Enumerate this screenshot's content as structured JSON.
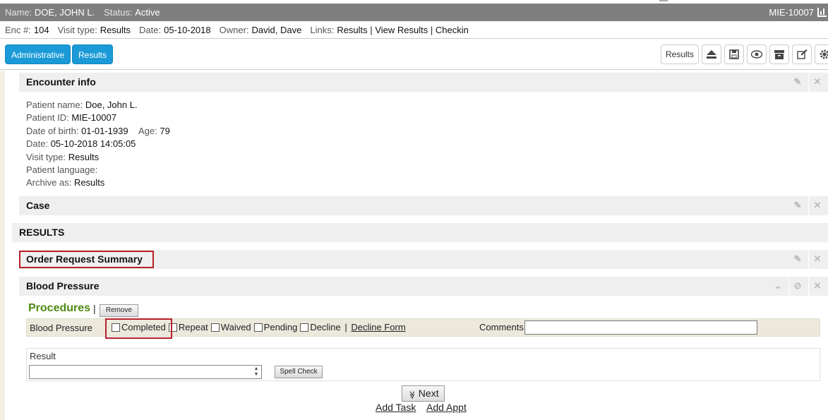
{
  "patient_bar": {
    "name_label": "Name:",
    "name_value": "DOE, JOHN L.",
    "status_label": "Status:",
    "status_value": "Active",
    "mie_id": "MIE-10007"
  },
  "encounter_bar": {
    "enc_label": "Enc #:",
    "enc_value": "104",
    "visit_type_label": "Visit type:",
    "visit_type_value": "Results",
    "date_label": "Date:",
    "date_value": "05-10-2018",
    "owner_label": "Owner:",
    "owner_value": "David, Dave",
    "links_label": "Links:",
    "link_results": "Results",
    "link_view_results": "View Results",
    "link_checkin": "Checkin",
    "link_separator": "|"
  },
  "toolbar": {
    "administrative": "Administrative",
    "results": "Results",
    "right_results": "Results",
    "icons": [
      "eject-icon",
      "save-icon",
      "eye-icon",
      "archive-icon",
      "edit-icon",
      "gear-icon"
    ]
  },
  "encounter_info": {
    "title": "Encounter info",
    "lines": {
      "patient_name_label": "Patient name:",
      "patient_name_value": "Doe, John L.",
      "patient_id_label": "Patient ID:",
      "patient_id_value": "MIE-10007",
      "dob_label": "Date of birth:",
      "dob_value": "01-01-1939",
      "age_label": "Age:",
      "age_value": "79",
      "date_label": "Date:",
      "date_value": "05-10-2018 14:05:05",
      "visit_type_label": "Visit type:",
      "visit_type_value": "Results",
      "language_label": "Patient language:",
      "language_value": "",
      "archive_label": "Archive as:",
      "archive_value": "Results"
    }
  },
  "case": {
    "title": "Case"
  },
  "results_section": {
    "title": "RESULTS"
  },
  "order_request": {
    "title": "Order Request Summary"
  },
  "blood_pressure": {
    "title": "Blood Pressure"
  },
  "procedures": {
    "title": "Procedures",
    "bar": "|",
    "remove": "Remove",
    "row_name": "Blood Pressure",
    "options": [
      "Completed",
      "Repeat",
      "Waived",
      "Pending",
      "Decline"
    ],
    "pipe": "|",
    "decline_form": "Decline Form",
    "comments_label": "Comments",
    "comments_value": ""
  },
  "result": {
    "label": "Result",
    "value": "",
    "spell_check": "Spell Check"
  },
  "footer": {
    "next": "Next",
    "add_task": "Add Task",
    "add_appt": "Add Appt"
  },
  "colors": {
    "blue_button": "#1a9ad6",
    "name_bar": "#7f7f7f",
    "procedures_green": "#4f8a10",
    "highlight_red": "#b8202a"
  }
}
